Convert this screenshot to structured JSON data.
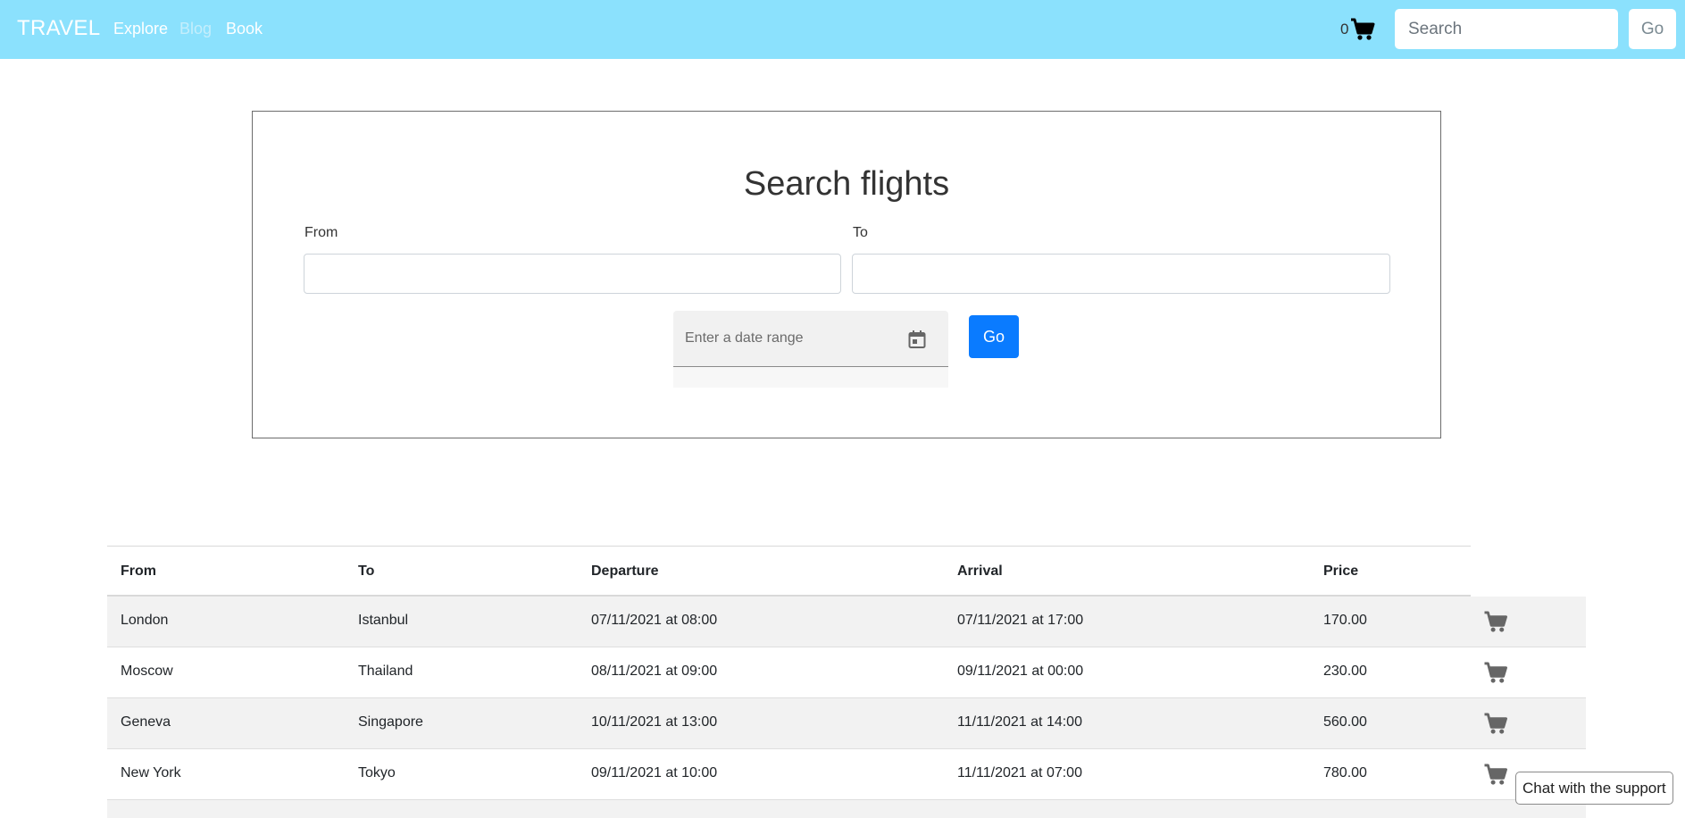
{
  "navbar": {
    "brand": "TRAVEL",
    "links": [
      {
        "label": "Explore"
      },
      {
        "label": "Blog"
      },
      {
        "label": "Book"
      }
    ],
    "cart_count": "0",
    "search_placeholder": "Search",
    "go_label": "Go",
    "background_color": "#8be1fd"
  },
  "search": {
    "title": "Search flights",
    "from_label": "From",
    "to_label": "To",
    "from_value": "",
    "to_value": "",
    "date_placeholder": "Enter a date range",
    "go_label": "Go",
    "go_color": "#0a7bff"
  },
  "table": {
    "headers": {
      "from": "From",
      "to": "To",
      "departure": "Departure",
      "arrival": "Arrival",
      "price": "Price"
    },
    "rows": [
      {
        "from": "London",
        "to": "Istanbul",
        "departure": "07/11/2021 at 08:00",
        "arrival": "07/11/2021 at 17:00",
        "price": "170.00"
      },
      {
        "from": "Moscow",
        "to": "Thailand",
        "departure": "08/11/2021 at 09:00",
        "arrival": "09/11/2021 at 00:00",
        "price": "230.00"
      },
      {
        "from": "Geneva",
        "to": "Singapore",
        "departure": "10/11/2021 at 13:00",
        "arrival": "11/11/2021 at 14:00",
        "price": "560.00"
      },
      {
        "from": "New York",
        "to": "Tokyo",
        "departure": "09/11/2021 at 10:00",
        "arrival": "11/11/2021 at 07:00",
        "price": "780.00"
      }
    ]
  },
  "chat": {
    "label": "Chat with the support"
  },
  "icons": {
    "cart": "cart-icon",
    "calendar": "calendar-icon"
  }
}
